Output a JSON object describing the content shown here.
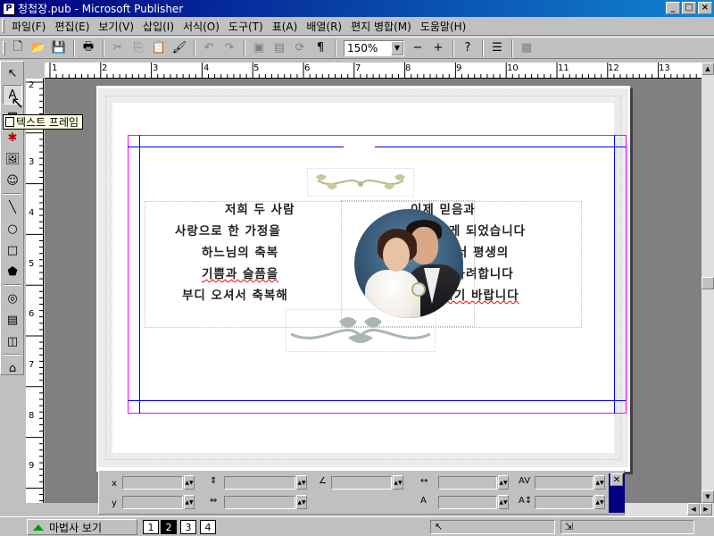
{
  "window": {
    "title": "청첩장.pub - Microsoft Publisher",
    "app_icon": "publisher-icon",
    "controls": [
      "_",
      "□",
      "×"
    ]
  },
  "menu": {
    "items": [
      "파일(F)",
      "편집(E)",
      "보기(V)",
      "삽입(I)",
      "서식(O)",
      "도구(T)",
      "표(A)",
      "배열(R)",
      "편지 병합(M)",
      "도움말(H)"
    ]
  },
  "toolbar": {
    "zoom_value": "150%",
    "zoom_out": "−",
    "zoom_in": "+"
  },
  "tooltip": {
    "text": "텍스트 프레임"
  },
  "ruler": {
    "h_numbers": [
      "1",
      "2",
      "3",
      "4",
      "5",
      "6",
      "7",
      "8",
      "9",
      "10",
      "11",
      "12",
      "13"
    ],
    "v_numbers": [
      "2",
      "3",
      "4",
      "5",
      "6",
      "7",
      "8",
      "9"
    ]
  },
  "document": {
    "left_lines": [
      "저희 두 사람",
      "사랑으로 한 가정을",
      "하느님의 축복",
      "기쁨과 슬픔을",
      "부디 오셔서 축복해"
    ],
    "right_lines": [
      "이제 믿음과",
      "이루게 되었습니다",
      "속에서 평생의",
      "함께 하려합니다",
      "주시기 바랍니다"
    ]
  },
  "format_bar": {
    "x_label": "x",
    "y_label": "y"
  },
  "status": {
    "wizard_label": "마법사 보기",
    "pages": [
      "1",
      "2",
      "3",
      "4"
    ],
    "active_page": "2"
  }
}
